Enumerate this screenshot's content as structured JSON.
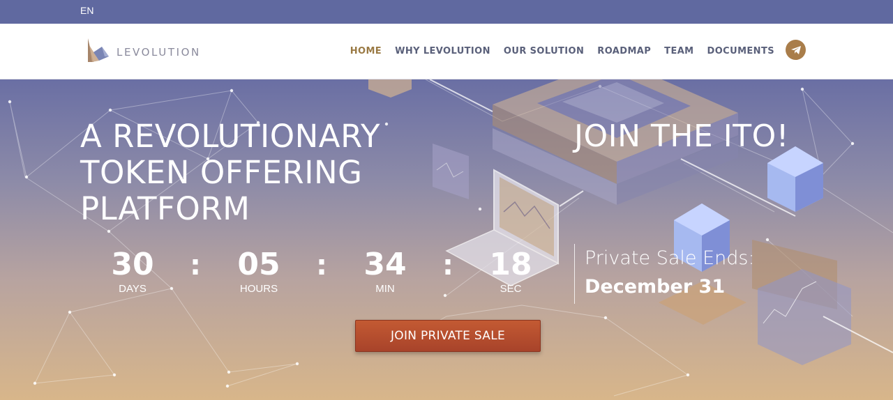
{
  "topbar": {
    "language": "EN"
  },
  "header": {
    "logo_text": "LEVOLUTION",
    "nav": [
      "HOME",
      "WHY LEVOLUTION",
      "OUR SOLUTION",
      "ROADMAP",
      "TEAM",
      "DOCUMENTS"
    ],
    "active_nav": "HOME",
    "telegram_icon": "telegram-icon"
  },
  "hero": {
    "headline": [
      "A REVOLUTIONARY",
      "TOKEN OFFERING",
      "PLATFORM"
    ],
    "join_title": "JOIN THE ITO!",
    "countdown": [
      {
        "value": "30",
        "label": "DAYS"
      },
      {
        "value": "05",
        "label": "HOURS"
      },
      {
        "value": "34",
        "label": "MIN"
      },
      {
        "value": "18",
        "label": "SEC"
      }
    ],
    "separator": ":",
    "sale_label": "Private Sale Ends:",
    "sale_date": "December 31",
    "cta_label": "JOIN PRIVATE SALE"
  },
  "colors": {
    "topbar": "#6069a0",
    "nav_active": "#9a7a44",
    "nav_text": "#5a607a",
    "cta": "#b54e2e",
    "telegram": "#a97d4a"
  }
}
